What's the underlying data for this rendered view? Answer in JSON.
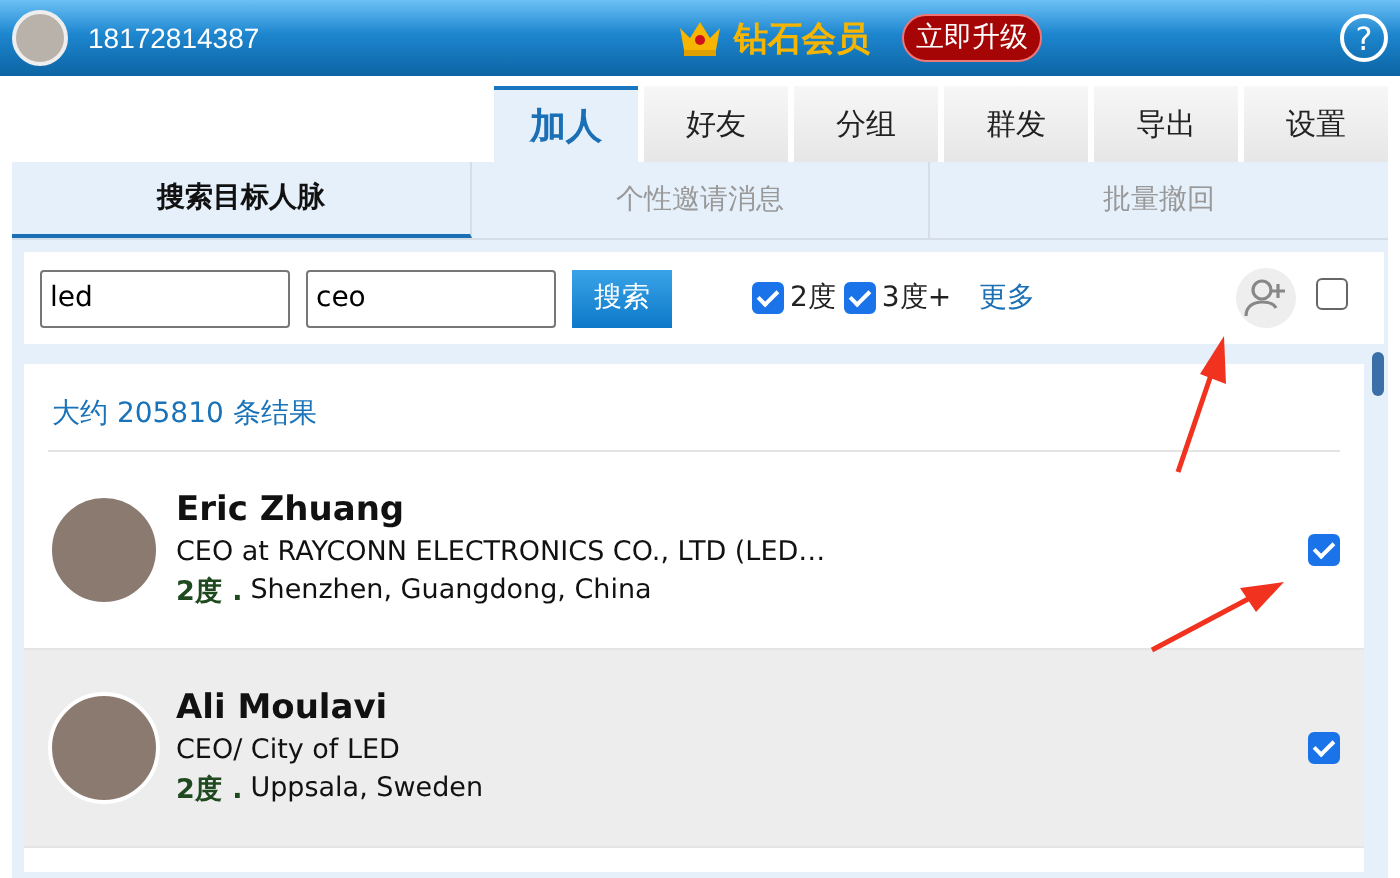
{
  "header": {
    "phone": "18172814387",
    "membership": "钻石会员",
    "upgrade_button": "立即升级",
    "help_button": "?"
  },
  "main_tabs": [
    {
      "label": "加人",
      "selected": true
    },
    {
      "label": "好友",
      "selected": false
    },
    {
      "label": "分组",
      "selected": false
    },
    {
      "label": "群发",
      "selected": false
    },
    {
      "label": "导出",
      "selected": false
    },
    {
      "label": "设置",
      "selected": false
    }
  ],
  "sub_tabs": [
    {
      "label": "搜索目标人脉",
      "selected": true
    },
    {
      "label": "个性邀请消息",
      "selected": false
    },
    {
      "label": "批量撤回",
      "selected": false
    }
  ],
  "search": {
    "keyword": "led",
    "title": "ceo",
    "search_button": "搜索",
    "filters": [
      {
        "label": "2度",
        "checked": true
      },
      {
        "label": "3度+",
        "checked": true
      }
    ],
    "more_link": "更多",
    "select_all": false
  },
  "results": {
    "summary": "大约 205810 条结果",
    "items": [
      {
        "name": "Eric Zhuang",
        "headline": "CEO at RAYCONN ELECTRONICS CO., LTD (LED…",
        "degree": "2度 .",
        "location": "Shenzhen, Guangdong, China",
        "checked": true,
        "selected": false
      },
      {
        "name": "Ali Moulavi",
        "headline": "CEO/ City of LED",
        "degree": "2度 .",
        "location": "Uppsala, Sweden",
        "checked": true,
        "selected": true
      }
    ]
  }
}
